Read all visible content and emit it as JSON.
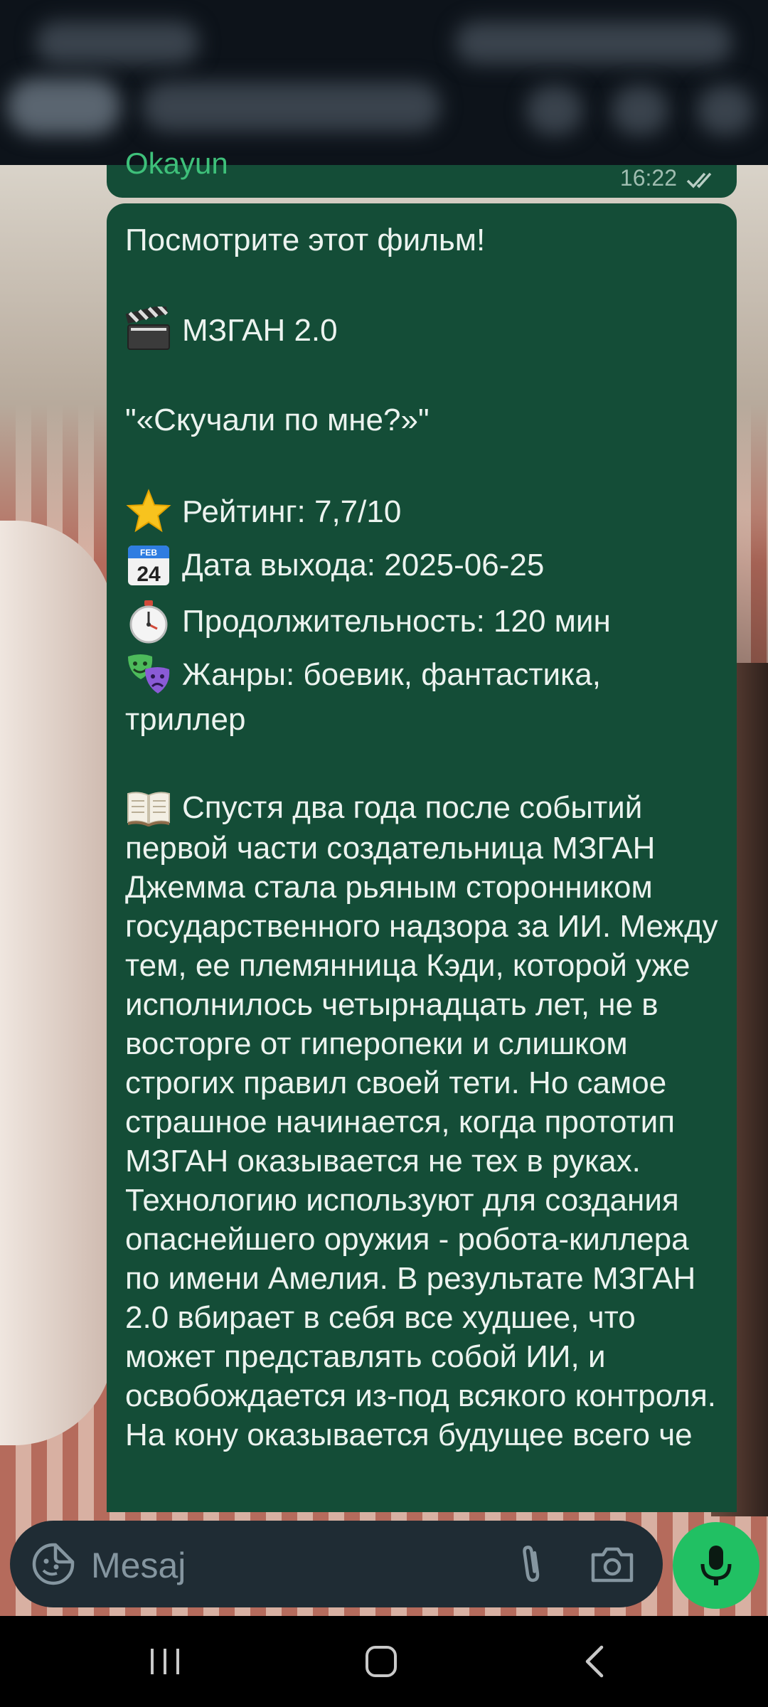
{
  "previous_message": {
    "text": "Okayun",
    "time": "16:22"
  },
  "message": {
    "intro": "Посмотрите этот фильм!",
    "title": "МЗГАН 2.0",
    "quote": "\"«Скучали по мне?»\"",
    "rating": "Рейтинг: 7,7/10",
    "release": "Дата выхода: 2025-06-25",
    "duration": "Продолжительность: 120 мин",
    "genres_line1": "Жанры: боевик, фантастика,",
    "genres_line2": "триллер",
    "description_first": "Спустя два года после событий",
    "description_rest": "первой части создательница МЗГАН Джемма стала рьяным сторонником государственного надзора за ИИ. Между тем, ее племянница Кэди, которой уже исполнилось четырнадцать лет, не в восторге от гиперопеки и слишком строгих правил своей тети. Но самое страшное начинается, когда прототип МЗГАН оказывается не тех в руках. Технологию используют для создания опаснейшего оружия - робота-киллера по имени Амелия. В результате МЗГАН 2.0 вбирает в себя все худшее, что может представлять собой ИИ, и освобождается из-под всякого контроля. На кону оказывается будущее всего че"
  },
  "input": {
    "placeholder": "Mesaj"
  },
  "icons": {
    "emoji": "sticker-emoji-icon",
    "clip": "paperclip-icon",
    "camera": "camera-icon",
    "mic": "microphone-icon",
    "nav_recent": "recent-apps-icon",
    "nav_home": "home-icon",
    "nav_back": "back-icon"
  },
  "colors": {
    "bubble": "#144d37",
    "accent": "#21c063",
    "input_bar": "#1f2c34"
  }
}
